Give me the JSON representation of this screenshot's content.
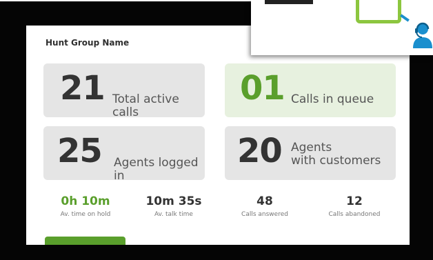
{
  "hunt_group": {
    "name": "Hunt Group Name"
  },
  "tiles": [
    {
      "value": "21",
      "label": "Total active calls"
    },
    {
      "value": "01",
      "label": "Calls in queue"
    },
    {
      "value": "25",
      "label": "Agents logged in"
    },
    {
      "value": "20",
      "label_line1": "Agents",
      "label_line2": "with customers"
    }
  ],
  "stats": [
    {
      "value": "0h 10m",
      "caption": "Av. time on hold"
    },
    {
      "value": "10m 35s",
      "caption": "Av. talk time"
    },
    {
      "value": "48",
      "caption": "Calls answered"
    },
    {
      "value": "12",
      "caption": "Calls abandoned"
    }
  ],
  "colors": {
    "accent_green": "#5a9f2c",
    "queue_tile_bg": "#e7f1df",
    "tile_bg": "#e5e5e5",
    "frame": "#050505",
    "callout_green": "#8cc63f",
    "callout_blue": "#1a8fce"
  },
  "icons": {
    "callout_agent": "headset-agent-icon"
  }
}
